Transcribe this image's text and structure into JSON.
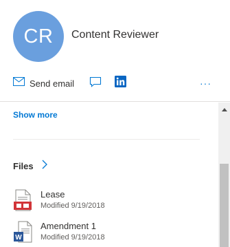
{
  "profile": {
    "initials": "CR",
    "name": "Content Reviewer",
    "avatar_color": "#6a9fde"
  },
  "actions": {
    "send_email_label": "Send email",
    "email_icon": "mail-icon",
    "chat_icon": "chat-icon",
    "linkedin_icon": "linkedin-icon",
    "more_label": "···"
  },
  "content": {
    "show_more_label": "Show more",
    "files_title": "Files",
    "files": [
      {
        "name": "Lease",
        "meta": "Modified 9/19/2018",
        "icon": "pdf-file-icon"
      },
      {
        "name": "Amendment 1",
        "meta": "Modified 9/19/2018",
        "icon": "word-file-icon"
      }
    ]
  },
  "colors": {
    "accent": "#0078d4",
    "linkedin": "#0a66c2"
  }
}
